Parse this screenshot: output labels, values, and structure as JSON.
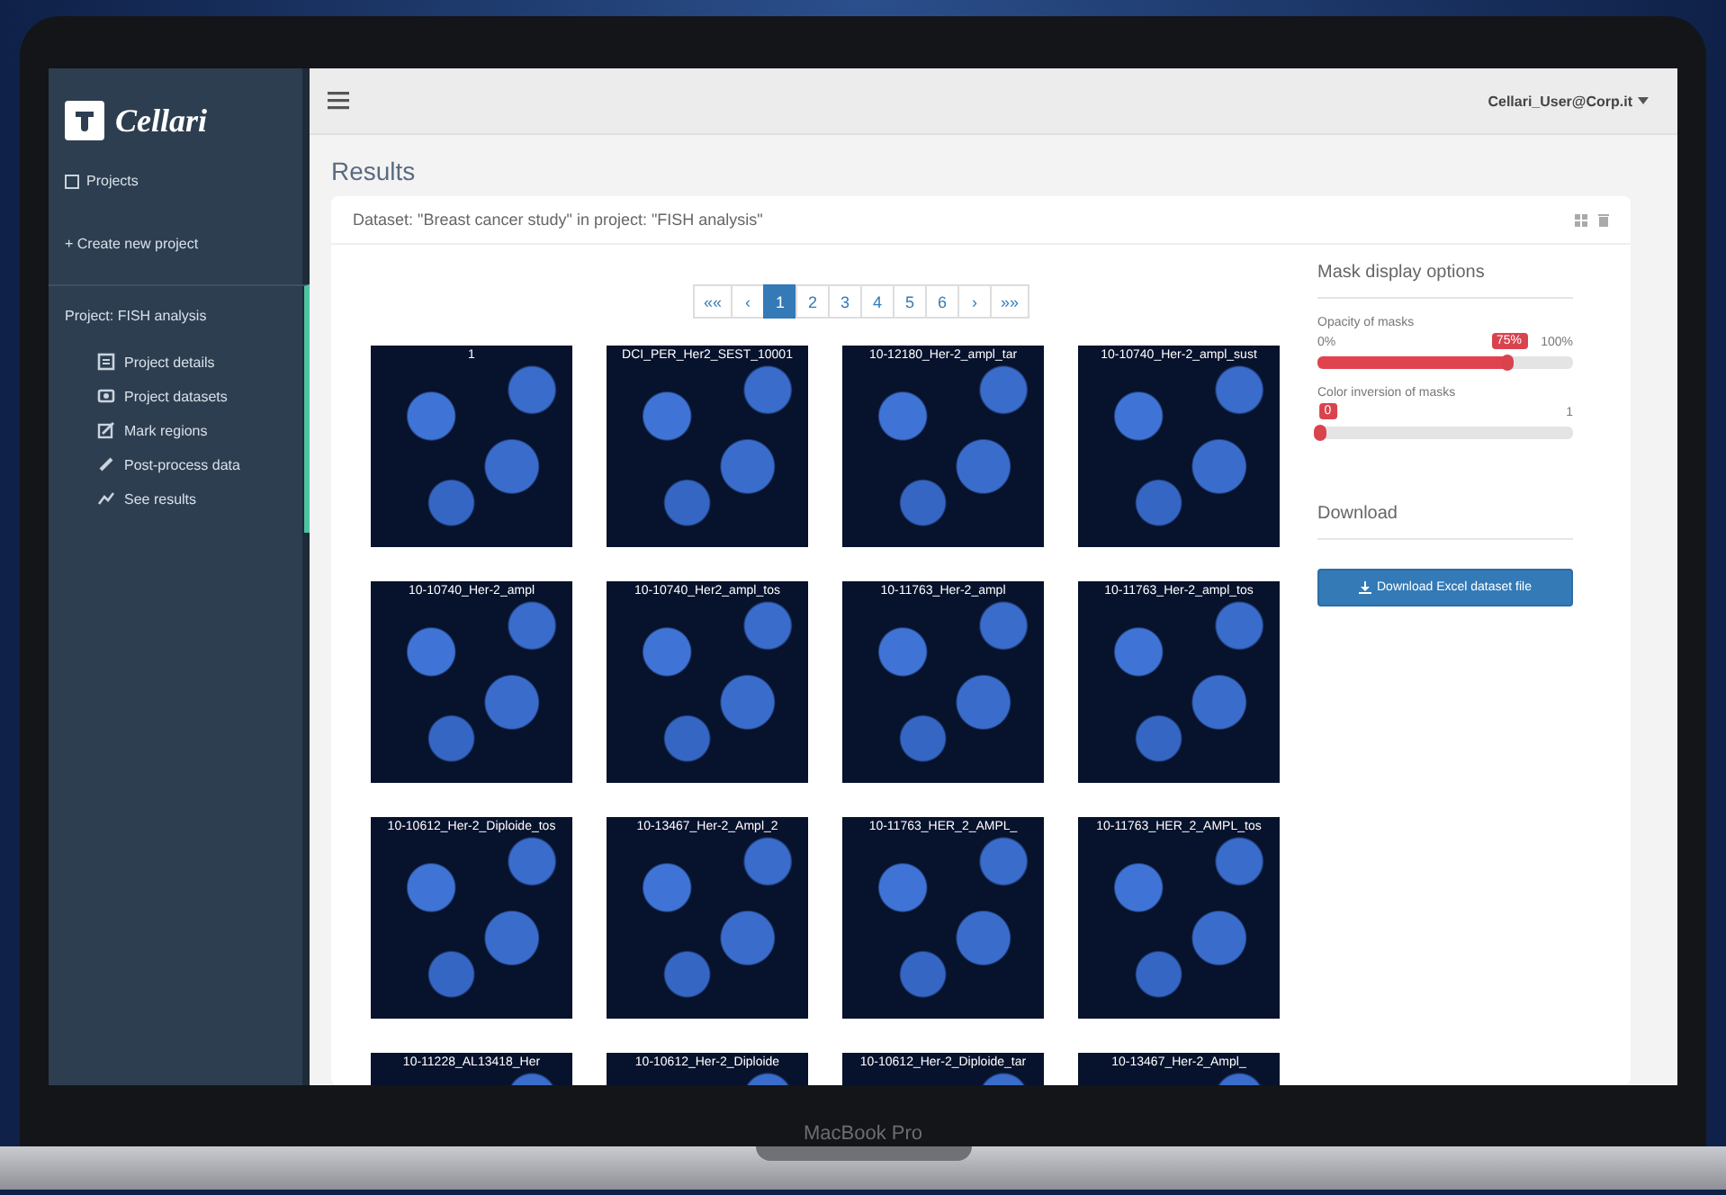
{
  "laptop": {
    "label": "MacBook Pro"
  },
  "sidebar": {
    "brand": "Cellari",
    "projects_link": "Projects",
    "create_link": "+ Create new project",
    "project_title": "Project: FISH analysis",
    "project_items": [
      {
        "label": "Project details",
        "kind": "details"
      },
      {
        "label": "Project datasets",
        "kind": "datasets"
      },
      {
        "label": "Mark regions",
        "kind": "mark"
      },
      {
        "label": "Post-process data",
        "kind": "process"
      },
      {
        "label": "See results",
        "kind": "results"
      }
    ]
  },
  "topbar": {
    "user": "Cellari_User@Corp.it"
  },
  "page_title": "Results",
  "panel": {
    "heading": "Dataset: \"Breast cancer study\" in project: \"FISH analysis\"",
    "pagination": [
      {
        "label": "««",
        "selected": false
      },
      {
        "label": "‹",
        "selected": false
      },
      {
        "label": "1",
        "selected": true
      },
      {
        "label": "2",
        "selected": false
      },
      {
        "label": "3",
        "selected": false
      },
      {
        "label": "4",
        "selected": false
      },
      {
        "label": "5",
        "selected": false
      },
      {
        "label": "6",
        "selected": false
      },
      {
        "label": "›",
        "selected": false
      },
      {
        "label": "»»",
        "selected": false
      }
    ],
    "images": [
      {
        "label": "1"
      },
      {
        "label": "DCI_PER_Her2_SEST_10001"
      },
      {
        "label": "10-12180_Her-2_ampl_tar"
      },
      {
        "label": "10-10740_Her-2_ampl_sust"
      },
      {
        "label": "10-10740_Her-2_ampl"
      },
      {
        "label": "10-10740_Her2_ampl_tos"
      },
      {
        "label": "10-11763_Her-2_ampl"
      },
      {
        "label": "10-11763_Her-2_ampl_tos"
      },
      {
        "label": "10-10612_Her-2_Diploide_tos"
      },
      {
        "label": "10-13467_Her-2_Ampl_2"
      },
      {
        "label": "10-11763_HER_2_AMPL_"
      },
      {
        "label": "10-11763_HER_2_AMPL_tos"
      },
      {
        "label": "10-11228_AL13418_Her"
      },
      {
        "label": "10-10612_Her-2_Diploide"
      },
      {
        "label": "10-10612_Her-2_Diploide_tar"
      },
      {
        "label": "10-13467_Her-2_Ampl_"
      }
    ]
  },
  "mask_options": {
    "title": "Mask display options",
    "sliders": [
      {
        "label": "Opacity of masks",
        "min": "0%",
        "max": "100%",
        "reading": "75%",
        "level": 0.75
      },
      {
        "label": "Color inversion of masks",
        "max": "1",
        "reading": "0",
        "level": 0
      }
    ]
  },
  "download": {
    "title": "Download",
    "button": "Download Excel dataset file"
  }
}
